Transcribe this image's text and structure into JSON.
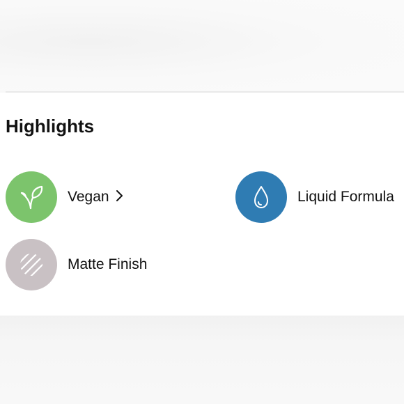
{
  "highlights": {
    "title": "Highlights",
    "items": [
      {
        "label": "Vegan",
        "icon": "leaf-icon",
        "color": "#7cc46c",
        "has_link": true
      },
      {
        "label": "Liquid Formula",
        "icon": "droplet-icon",
        "color": "#2f7cb3",
        "has_link": false
      },
      {
        "label": "Matte Finish",
        "icon": "striped-circle-icon",
        "color": "#c9c1c4",
        "has_link": false
      }
    ]
  }
}
